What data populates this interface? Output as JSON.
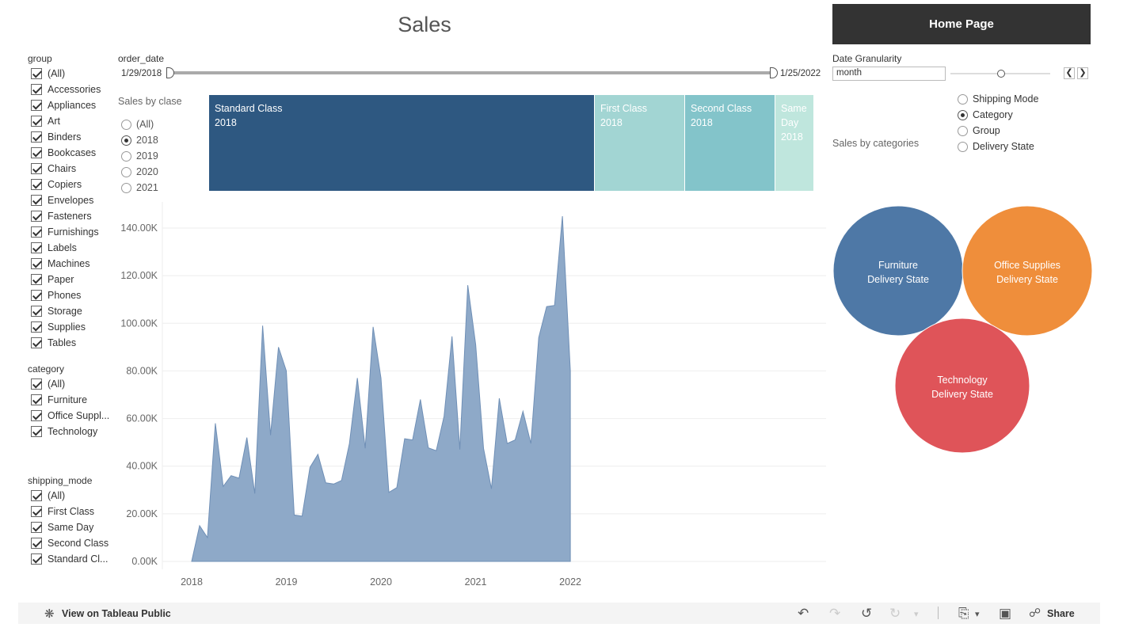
{
  "title": "Sales",
  "home_button": "Home Page",
  "filters": {
    "group": {
      "title": "group",
      "items": [
        "(All)",
        "Accessories",
        "Appliances",
        "Art",
        "Binders",
        "Bookcases",
        "Chairs",
        "Copiers",
        "Envelopes",
        "Fasteners",
        "Furnishings",
        "Labels",
        "Machines",
        "Paper",
        "Phones",
        "Storage",
        "Supplies",
        "Tables"
      ]
    },
    "category": {
      "title": "category",
      "items": [
        "(All)",
        "Furniture",
        "Office Suppl...",
        "Technology"
      ]
    },
    "shipping_mode": {
      "title": "shipping_mode",
      "items": [
        "(All)",
        "First Class",
        "Same Day",
        "Second Class",
        "Standard Cl..."
      ]
    }
  },
  "order_date": {
    "title": "order_date",
    "start": "1/29/2018",
    "end": "1/25/2022"
  },
  "sales_by_class": {
    "title": "Sales by clase",
    "options": [
      "(All)",
      "2018",
      "2019",
      "2020",
      "2021"
    ],
    "selected": "2018"
  },
  "class_bar": [
    {
      "line1": "Standard Class",
      "line2": "2018",
      "line3": "",
      "share": 0.638,
      "color": "#2e5881"
    },
    {
      "line1": "First Class",
      "line2": "2018",
      "line3": "",
      "share": 0.149,
      "color": "#a2d5d3"
    },
    {
      "line1": "Second Class",
      "line2": "2018",
      "line3": "",
      "share": 0.149,
      "color": "#83c4ca"
    },
    {
      "line1": "Same",
      "line2": "Day",
      "line3": "2018",
      "share": 0.064,
      "color": "#bfe6dd"
    }
  ],
  "date_granularity": {
    "title": "Date Granularity",
    "value": "month",
    "prev_icon": "chevron-left-icon",
    "next_icon": "chevron-right-icon"
  },
  "sales_by_categories": {
    "title": "Sales by categories",
    "options": [
      "Shipping Mode",
      "Category",
      "Group",
      "Delivery State"
    ],
    "selected": "Category"
  },
  "bubbles": [
    {
      "line1": "Furniture",
      "line2": "Delivery State",
      "color": "#4e78a6"
    },
    {
      "line1": "Office Supplies",
      "line2": "Delivery State",
      "color": "#ef8e3b"
    },
    {
      "line1": "Technology",
      "line2": "Delivery State",
      "color": "#df5459"
    }
  ],
  "chart_data": {
    "type": "area",
    "title": "",
    "xlabel": "",
    "ylabel": "",
    "color": "#8ea9c8",
    "x_ticks": [
      "2018",
      "2019",
      "2020",
      "2021",
      "2022"
    ],
    "y_ticks": [
      "0.00K",
      "20.00K",
      "40.00K",
      "60.00K",
      "80.00K",
      "100.00K",
      "120.00K",
      "140.00K"
    ],
    "ylim": [
      0,
      150000
    ],
    "x_start": "2018-01",
    "values": [
      0,
      15000,
      10000,
      58000,
      31500,
      36000,
      35000,
      52000,
      28500,
      99000,
      53000,
      90000,
      80000,
      19500,
      19000,
      39500,
      45000,
      33000,
      32500,
      34000,
      49500,
      77000,
      47500,
      98500,
      77000,
      29000,
      31000,
      51500,
      51000,
      68000,
      47700,
      46500,
      61000,
      94500,
      47000,
      116000,
      91000,
      47500,
      30500,
      68500,
      49500,
      51000,
      63000,
      49500,
      94000,
      107000,
      107500,
      145000,
      80000
    ]
  },
  "toolbar": {
    "view_label": "View on Tableau Public",
    "share_label": "Share"
  }
}
